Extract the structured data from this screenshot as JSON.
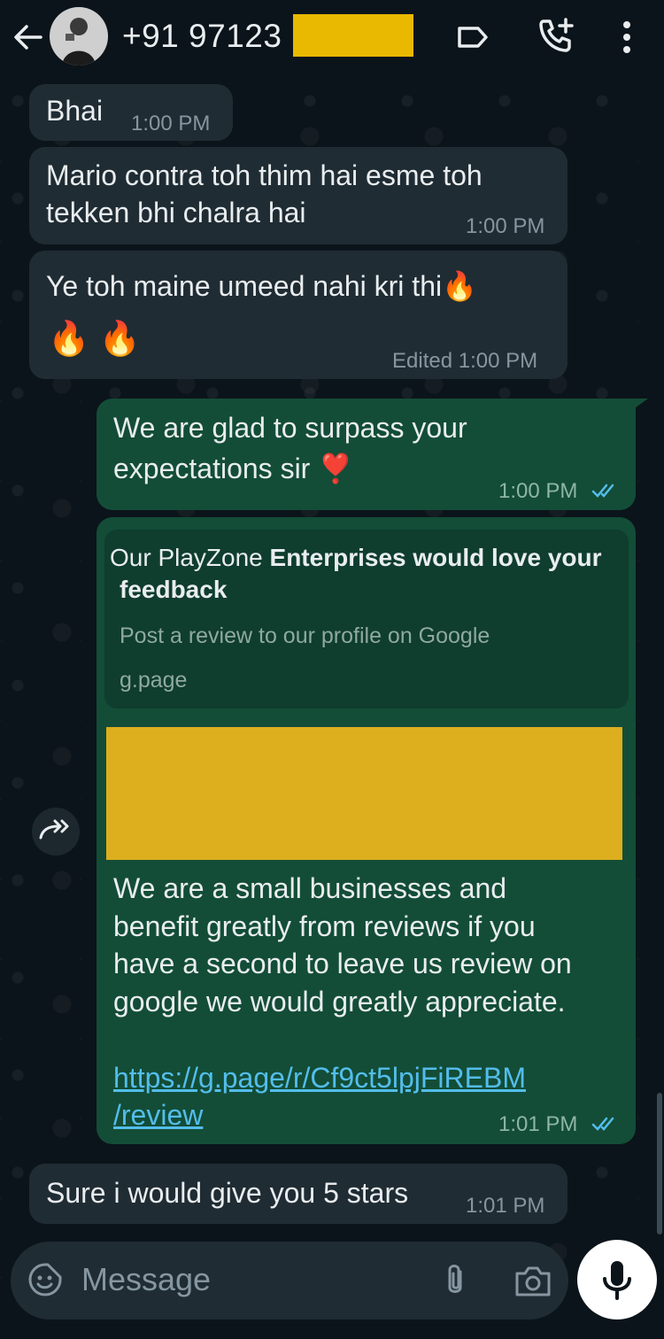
{
  "header": {
    "contact_name": "+91 97123"
  },
  "messages": [
    {
      "text": "Bhai",
      "time": "1:00 PM"
    },
    {
      "line1": "Mario contra toh thim hai esme toh",
      "line2": "tekken bhi chalra hai",
      "time": "1:00 PM"
    },
    {
      "line1": "Ye toh maine umeed nahi kri thi",
      "emoji1": "🔥",
      "emoji_line": "🔥 🔥",
      "edited": "Edited",
      "time": "1:00 PM"
    },
    {
      "line1": "We are glad to surpass your",
      "line2": "expectations sir",
      "emoji": "❣️",
      "time": "1:00 PM"
    },
    {
      "card_title_plain": "Our PlayZone ",
      "card_title_bold_1": "Enterprises would love your",
      "card_title_bold_2": "feedback",
      "card_desc": "Post a review to our profile on Google",
      "card_domain": "g.page",
      "body_line1": "We are a small businesses and",
      "body_line2": "benefit greatly from reviews if you",
      "body_line3": "have a second to leave us review on",
      "body_line4": "google we would greatly appreciate.",
      "link_line1": "https://g.page/r/Cf9ct5lpjFiREBM",
      "link_line2": "/review",
      "time": "1:01 PM"
    },
    {
      "text": "Sure i would give you 5 stars",
      "time": "1:01 PM"
    }
  ],
  "composer": {
    "placeholder": "Message"
  },
  "colors": {
    "incoming_bubble": "#202c33",
    "outgoing_bubble": "#134d37",
    "link": "#53bdeb",
    "read_ticks": "#53bdeb",
    "redaction": "#e9b800"
  },
  "icons": [
    "back-arrow-icon",
    "label-icon",
    "add-call-icon",
    "more-vert-icon",
    "forward-icon",
    "emoji-icon",
    "attach-icon",
    "camera-icon",
    "mic-icon",
    "double-check-icon"
  ]
}
